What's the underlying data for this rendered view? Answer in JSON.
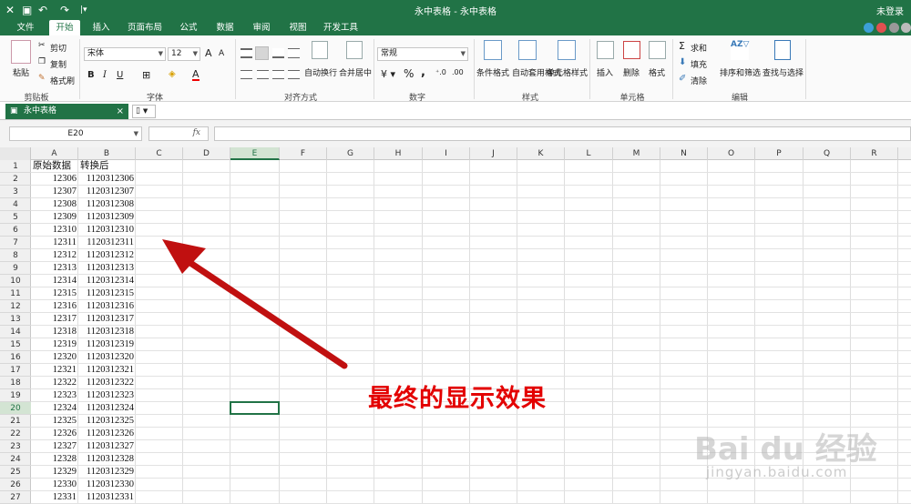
{
  "window": {
    "title": "永中表格 - 永中表格",
    "login": "未登录",
    "quick_access": [
      "X",
      "🖫",
      "↶",
      "↷",
      "⁞▾"
    ]
  },
  "ribbon_tabs": [
    "文件",
    "开始",
    "插入",
    "页面布局",
    "公式",
    "数据",
    "审阅",
    "视图",
    "开发工具"
  ],
  "active_tab": "开始",
  "ribbon": {
    "clipboard": {
      "paste": "粘贴",
      "cut": "剪切",
      "copy": "复制",
      "format_painter": "格式刷",
      "label": "剪贴板"
    },
    "font": {
      "name": "宋体",
      "size": "12",
      "bold": "B",
      "italic": "I",
      "underline": "U",
      "label": "字体",
      "grow": "A",
      "shrink": "A"
    },
    "alignment": {
      "wrap": "自动换行",
      "merge": "合并居中",
      "label": "对齐方式"
    },
    "number": {
      "format": "常规",
      "percent": "%",
      "comma": ",",
      "label": "数字"
    },
    "styles": {
      "conditional": "条件格式",
      "table": "自动套用格式",
      "cell": "单元格样式",
      "label": "样式"
    },
    "cells": {
      "insert": "插入",
      "delete": "删除",
      "format": "格式",
      "label": "单元格"
    },
    "editing": {
      "sum": "求和",
      "fill": "填充",
      "clear": "清除",
      "sort": "排序和筛选",
      "find": "查找与选择",
      "label": "编辑"
    }
  },
  "document_tab": {
    "name": "永中表格",
    "close": "×"
  },
  "formula_bar": {
    "name_box": "E20",
    "fx": "fx",
    "content": ""
  },
  "columns": [
    "A",
    "B",
    "C",
    "D",
    "E",
    "F",
    "G",
    "H",
    "I",
    "J",
    "K",
    "L",
    "M",
    "N",
    "O",
    "P",
    "Q",
    "R"
  ],
  "selected_column": "E",
  "selected_row": 20,
  "rows": [
    1,
    2,
    3,
    4,
    5,
    6,
    7,
    8,
    9,
    10,
    11,
    12,
    13,
    14,
    15,
    16,
    17,
    18,
    19,
    20,
    21,
    22,
    23,
    24,
    25,
    26,
    27
  ],
  "sheet_data": {
    "header": [
      "原始数据",
      "转换后"
    ],
    "original": [
      12306,
      12307,
      12308,
      12309,
      12310,
      12311,
      12312,
      12313,
      12314,
      12315,
      12316,
      12317,
      12318,
      12319,
      12320,
      12321,
      12322,
      12323,
      12324,
      12325,
      12326,
      12327,
      12328,
      12329,
      12330,
      12331
    ],
    "converted": [
      1120312306,
      1120312307,
      1120312308,
      1120312309,
      1120312310,
      1120312311,
      1120312312,
      1120312313,
      1120312314,
      1120312315,
      1120312316,
      1120312317,
      1120312318,
      1120312319,
      1120312320,
      1120312321,
      1120312322,
      1120312323,
      1120312324,
      1120312325,
      1120312326,
      1120312327,
      1120312328,
      1120312329,
      1120312330,
      1120312331
    ]
  },
  "annotation": {
    "text": "最终的显示效果",
    "color": "#e30000"
  },
  "watermark": {
    "logo": "Bai du 经验",
    "url": "jingyan.baidu.com"
  },
  "colors": {
    "accent": "#217346"
  }
}
